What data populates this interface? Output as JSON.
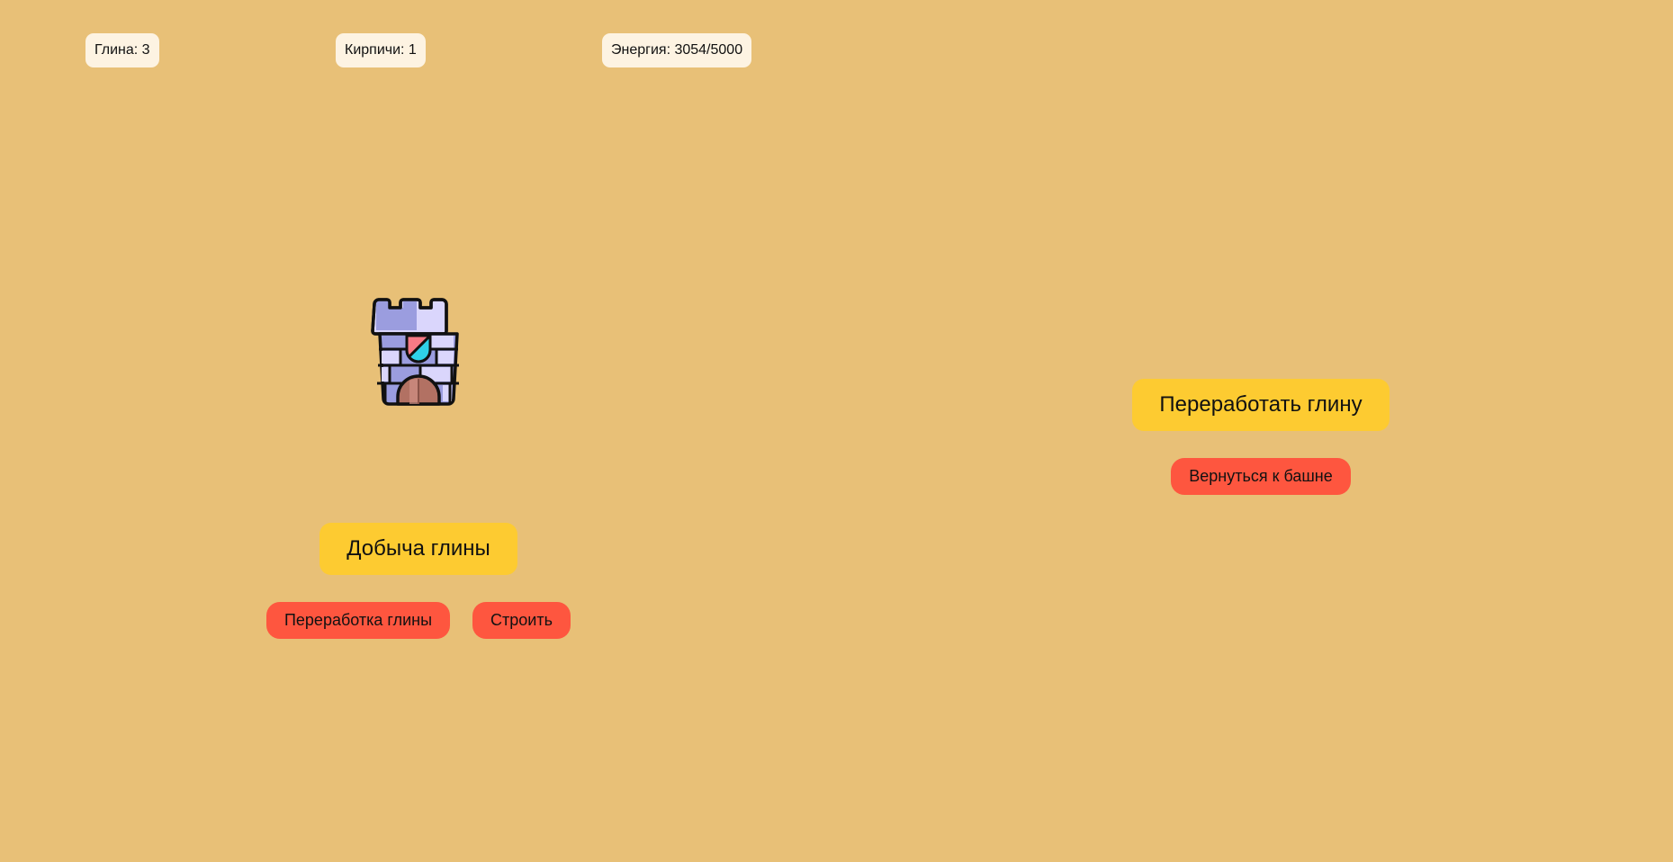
{
  "stats": {
    "clay": "Глина: 3",
    "bricks": "Кирпичи: 1",
    "energy": "Энергия: 3054/5000"
  },
  "tower_view": {
    "tower_icon": "castle-tower-icon",
    "mine_button": "Добыча глины",
    "process_nav_button": "Переработка глины",
    "build_button": "Строить"
  },
  "processing_view": {
    "process_button": "Переработать глину",
    "back_button": "Вернуться к башне"
  },
  "colors": {
    "background": "#e8c077",
    "stat_badge": "#fdf3e2",
    "primary_button": "#fdcb31",
    "secondary_button": "#fe563f"
  }
}
